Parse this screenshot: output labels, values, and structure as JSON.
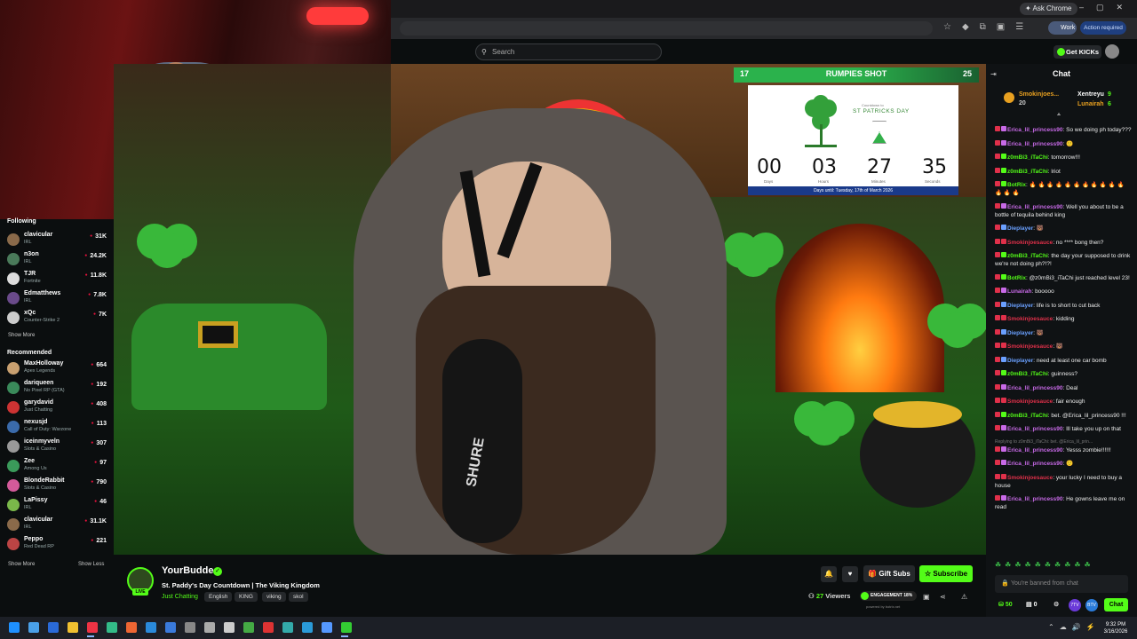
{
  "browser": {
    "ask_chrome": "Ask Chrome",
    "profile_label": "Work",
    "action_required": "Action required"
  },
  "kick_header": {
    "search_placeholder": "Search",
    "get_kicks": "Get KICKs"
  },
  "sidebar": {
    "following_heading": "Following",
    "following": [
      {
        "name": "clavicular",
        "category": "IRL",
        "viewers": "31K",
        "color": "#8a6a4a"
      },
      {
        "name": "n3on",
        "category": "IRL",
        "viewers": "24.2K",
        "color": "#4a7a5a"
      },
      {
        "name": "TJR",
        "category": "Fortnite",
        "viewers": "11.8K",
        "color": "#ddd"
      },
      {
        "name": "Edmatthews",
        "category": "IRL",
        "viewers": "7.8K",
        "color": "#6a4a8a"
      },
      {
        "name": "xQc",
        "category": "Counter-Strike 2",
        "viewers": "7K",
        "color": "#ccc"
      }
    ],
    "show_more_1": "Show More",
    "recommended_heading": "Recommended",
    "recommended": [
      {
        "name": "MaxHolloway",
        "category": "Apex Legends",
        "viewers": "664",
        "color": "#c8a070"
      },
      {
        "name": "dariqueen",
        "category": "No Pixel RP (GTA)",
        "viewers": "192",
        "color": "#3a8a5a"
      },
      {
        "name": "garydavid",
        "category": "Just Chatting",
        "viewers": "408",
        "color": "#c33"
      },
      {
        "name": "nexusjd",
        "category": "Call of Duty: Warzone",
        "viewers": "113",
        "color": "#3a6aaa"
      },
      {
        "name": "iceinmyveln",
        "category": "Slots & Casino",
        "viewers": "307",
        "color": "#999"
      },
      {
        "name": "Zee",
        "category": "Among Us",
        "viewers": "97",
        "color": "#3a9a5a"
      },
      {
        "name": "BlondeRabbit",
        "category": "Slots & Casino",
        "viewers": "790",
        "color": "#d35a9a"
      },
      {
        "name": "LaPissy",
        "category": "IRL",
        "viewers": "46",
        "color": "#7ab84a"
      },
      {
        "name": "clavicular",
        "category": "IRL",
        "viewers": "31.1K",
        "color": "#8a6a4a"
      },
      {
        "name": "Peppo",
        "category": "Red Dead RP",
        "viewers": "221",
        "color": "#b44"
      }
    ],
    "show_more_2": "Show More",
    "show_less": "Show Less"
  },
  "overlay": {
    "left_num": "17",
    "center": "RUMPIES SHOT",
    "right_num": "25"
  },
  "countdown": {
    "tag": "Countdown to",
    "title": "ST PATRICKS DAY",
    "days": "00",
    "hours": "03",
    "minutes": "27",
    "seconds": "35",
    "days_label": "Days",
    "hours_label": "Hours",
    "minutes_label": "Minutes",
    "seconds_label": "Seconds",
    "footer": "Days until: Tuesday, 17th of March 2026"
  },
  "video": {
    "mic_brand": "SHURE"
  },
  "stream": {
    "channel": "YourBudde",
    "live": "LIVE",
    "title": "St. Paddy's Day Countdown | The Viking Kingdom",
    "category": "Just Chatting",
    "tags": [
      "English",
      "KING",
      "viking",
      "skol"
    ],
    "gift_subs": "Gift Subs",
    "subscribe": "Subscribe",
    "viewers_count": "27",
    "viewers_label": "Viewers",
    "engagement": "ENGAGEMENT 18%",
    "powered_by": "powered by botrix.net"
  },
  "chat": {
    "heading": "Chat",
    "gifter_1_name": "Smokinjoes...",
    "gifter_1_count": "20",
    "gifter_2_name": "Xentreyu",
    "gifter_2_count": "9",
    "gifter_3_name": "Lunairah",
    "gifter_3_count": "6",
    "messages": [
      {
        "user": "Erica_lil_princess90",
        "text": ": So we doing ph today???",
        "color": "#c86ae8"
      },
      {
        "user": "Erica_lil_princess90",
        "text": ": 🙂",
        "color": "#c86ae8"
      },
      {
        "user": "z0mBi3_iTaChi",
        "text": ": tomorrow!!!",
        "color": "#53fc18"
      },
      {
        "user": "z0mBi3_iTaChi",
        "text": ": lriot",
        "color": "#53fc18"
      },
      {
        "user": "BotRix",
        "text": ": 🔥 🔥 🔥 🔥 🔥 🔥 🔥 🔥 🔥 🔥 🔥 🔥 🔥 🔥",
        "color": "#53fc18"
      },
      {
        "user": "Erica_lil_princess90",
        "text": ": Well you about to be a bottle of tequila behind king",
        "color": "#c86ae8"
      },
      {
        "user": "Dieplayer",
        "text": ": 🐻",
        "color": "#6aa0ff"
      },
      {
        "user": "Smokinjoesauce",
        "text": ": no **** bong then?",
        "color": "#e0304a"
      },
      {
        "user": "z0mBi3_iTaChi",
        "text": ": the day your supposed to drink we're not doing ph?!?!",
        "color": "#53fc18"
      },
      {
        "user": "BotRix",
        "text": ": @z0mBi3_iTaChi just reached level 23!",
        "color": "#53fc18"
      },
      {
        "user": "Lunairah",
        "text": ": booooo",
        "color": "#c86ae8"
      },
      {
        "user": "Dieplayer",
        "text": ": life is to short to cut back",
        "color": "#6aa0ff"
      },
      {
        "user": "Smokinjoesauce",
        "text": ": kidding",
        "color": "#e0304a"
      },
      {
        "user": "Dieplayer",
        "text": ": 🐻",
        "color": "#6aa0ff"
      },
      {
        "user": "Smokinjoesauce",
        "text": ": 🐻",
        "color": "#e0304a"
      },
      {
        "user": "Dieplayer",
        "text": ": need at least one car bomb",
        "color": "#6aa0ff"
      },
      {
        "user": "z0mBi3_iTaChi",
        "text": ": guinness?",
        "color": "#53fc18"
      },
      {
        "user": "Erica_lil_princess90",
        "text": ": Deal",
        "color": "#c86ae8"
      },
      {
        "user": "Smokinjoesauce",
        "text": ": fair enough",
        "color": "#e0304a"
      },
      {
        "user": "z0mBi3_iTaChi",
        "text": ": bet. @Erica_lil_princess90 !!!",
        "color": "#53fc18"
      },
      {
        "user": "Erica_lil_princess90",
        "text": ": Ill take you up on that",
        "color": "#c86ae8"
      }
    ],
    "reply_hint": "Replying to z0mBi3_iTaChi: bet. @Erica_lil_prin...",
    "messages_2": [
      {
        "user": "Erica_lil_princess90",
        "text": ": Yesss zombie!!!!!!",
        "color": "#c86ae8"
      },
      {
        "user": "Erica_lil_princess90",
        "text": ": 🙂",
        "color": "#c86ae8"
      },
      {
        "user": "Smokinjoesauce",
        "text": ": your lucky I need to buy a house",
        "color": "#e0304a"
      },
      {
        "user": "Erica_lil_princess90",
        "text": ": He gowns leave me on read",
        "color": "#c86ae8"
      }
    ],
    "banned_text": "You're banned from chat",
    "kicks_count": "50",
    "other_count": "0",
    "chat_button": "Chat"
  },
  "taskbar": {
    "time": "9:32 PM",
    "date": "3/16/2026"
  }
}
